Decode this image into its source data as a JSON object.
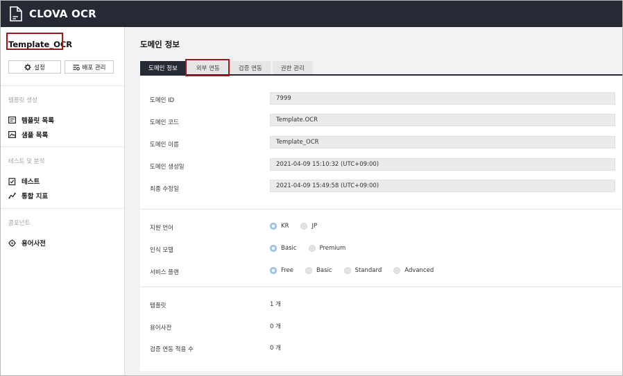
{
  "app": {
    "title": "CLOVA OCR"
  },
  "sidebar": {
    "template_name": "Template_OCR",
    "buttons": {
      "settings": "설정",
      "deploy": "배포 관리"
    },
    "sections": [
      {
        "label": "템플릿 생성",
        "items": [
          "템플릿 목록",
          "샘플 목록"
        ]
      },
      {
        "label": "테스트 및 분석",
        "items": [
          "테스트",
          "통합 지표"
        ]
      },
      {
        "label": "콤포넌트",
        "items": [
          "용어사전"
        ]
      }
    ]
  },
  "main": {
    "page_title": "도메인 정보",
    "tabs": [
      "도메인 정보",
      "외부 연동",
      "검증 연동",
      "권한 관리"
    ],
    "active_tab": "도메인 정보",
    "info": [
      {
        "label": "도메인 ID",
        "value": "7999"
      },
      {
        "label": "도메인 코드",
        "value": "Template.OCR"
      },
      {
        "label": "도메인 이름",
        "value": "Template_OCR"
      },
      {
        "label": "도메인 생성일",
        "value": "2021-04-09 15:10:32 (UTC+09:00)"
      },
      {
        "label": "최종 수정일",
        "value": "2021-04-09 15:49:58 (UTC+09:00)"
      }
    ],
    "options": [
      {
        "label": "지원 언어",
        "choices": [
          "KR",
          "JP"
        ],
        "selected": "KR"
      },
      {
        "label": "인식 모델",
        "choices": [
          "Basic",
          "Premium"
        ],
        "selected": "Basic"
      },
      {
        "label": "서비스 플랜",
        "choices": [
          "Free",
          "Basic",
          "Standard",
          "Advanced"
        ],
        "selected": "Free"
      }
    ],
    "counts": [
      {
        "label": "템플릿",
        "value": "1 개"
      },
      {
        "label": "용어사전",
        "value": "0 개"
      },
      {
        "label": "검증 연동 적용 수",
        "value": "0 개"
      }
    ]
  },
  "colors": {
    "topbar": "#262a35",
    "highlight": "#a1161b",
    "radio_on": "#a7c8ec"
  }
}
